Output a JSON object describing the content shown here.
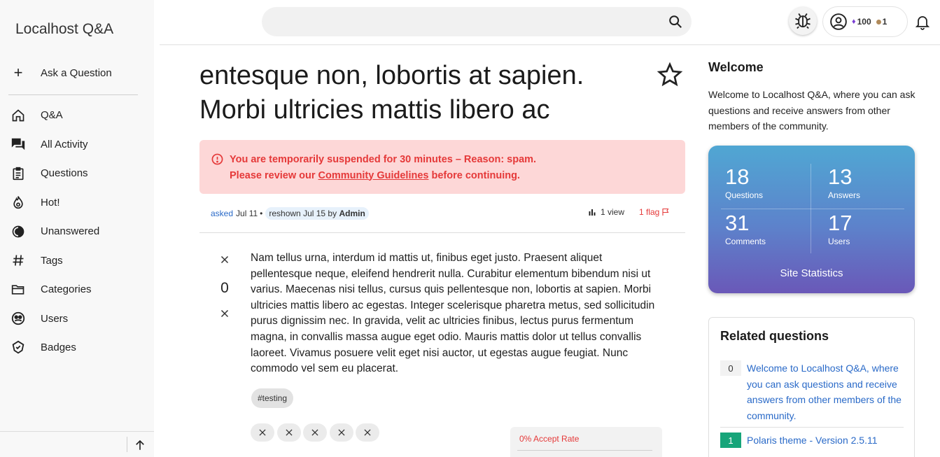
{
  "sidebar": {
    "brand": "Localhost Q&A",
    "ask": "Ask a Question",
    "items": [
      {
        "label": "Q&A",
        "icon": "home-icon"
      },
      {
        "label": "All Activity",
        "icon": "chat-icon"
      },
      {
        "label": "Questions",
        "icon": "clipboard-icon"
      },
      {
        "label": "Hot!",
        "icon": "fire-icon"
      },
      {
        "label": "Unanswered",
        "icon": "half-circle-icon"
      },
      {
        "label": "Tags",
        "icon": "hash-icon"
      },
      {
        "label": "Categories",
        "icon": "folder-icon"
      },
      {
        "label": "Users",
        "icon": "users-icon"
      },
      {
        "label": "Badges",
        "icon": "badge-icon"
      }
    ]
  },
  "header": {
    "search_placeholder": "",
    "user": {
      "points": "100",
      "bronze": "1"
    }
  },
  "question": {
    "title": "entesque non, lobortis at sapien. Morbi ultricies mattis libero ac",
    "alert": {
      "line1": "You are temporarily suspended for 30 minutes – Reason: spam.",
      "line2_prefix": "Please review our ",
      "link": "Community Guidelines",
      "line2_suffix": " before continuing."
    },
    "meta": {
      "asked": "asked",
      "asked_date": "Jul 11",
      "bullet": "•",
      "reshown": "reshown Jul 15 by",
      "reshown_by": "Admin"
    },
    "views": "1 view",
    "flags": "1 flag",
    "votes": "0",
    "body": "Nam tellus urna, interdum id mattis ut, finibus eget justo. Praesent aliquet pellentesque neque, eleifend hendrerit nulla. Curabitur elementum bibendum nisi ut varius. Maecenas nisi tellus, cursus quis pellentesque non, lobortis at sapien. Morbi ultricies mattis libero ac egestas. Integer scelerisque pharetra metus, sed sollicitudin purus dignissim nec. In gravida, velit ac ultricies finibus, lectus purus fermentum magna, in convallis massa augue eget odio. Mauris mattis dolor ut tellus convallis laoreet. Vivamus posuere velit eget nisi auctor, ut egestas augue feugiat. Nunc commodo vel sem eu placerat.",
    "tag": "#testing",
    "accept_rate": "0% Accept Rate"
  },
  "welcome": {
    "title": "Welcome",
    "text": "Welcome to Localhost Q&A, where you can ask questions and receive answers from other members of the community."
  },
  "stats": {
    "questions": {
      "value": "18",
      "label": "Questions"
    },
    "answers": {
      "value": "13",
      "label": "Answers"
    },
    "comments": {
      "value": "31",
      "label": "Comments"
    },
    "users": {
      "value": "17",
      "label": "Users"
    },
    "title": "Site Statistics"
  },
  "related": {
    "title": "Related questions",
    "items": [
      {
        "count": "0",
        "text": "Welcome to Localhost Q&A, where you can ask questions and receive answers from other members of the community."
      },
      {
        "count": "1",
        "text": "Polaris theme - Version 2.5.11"
      }
    ]
  },
  "colors": {
    "accent_blue": "#2a6ac8",
    "alert_bg": "#fdd7d7",
    "alert_text": "#e53939",
    "answered_green": "#17a57a",
    "stats_gradient_top": "#50a7d3",
    "stats_gradient_bottom": "#6a58b8"
  }
}
